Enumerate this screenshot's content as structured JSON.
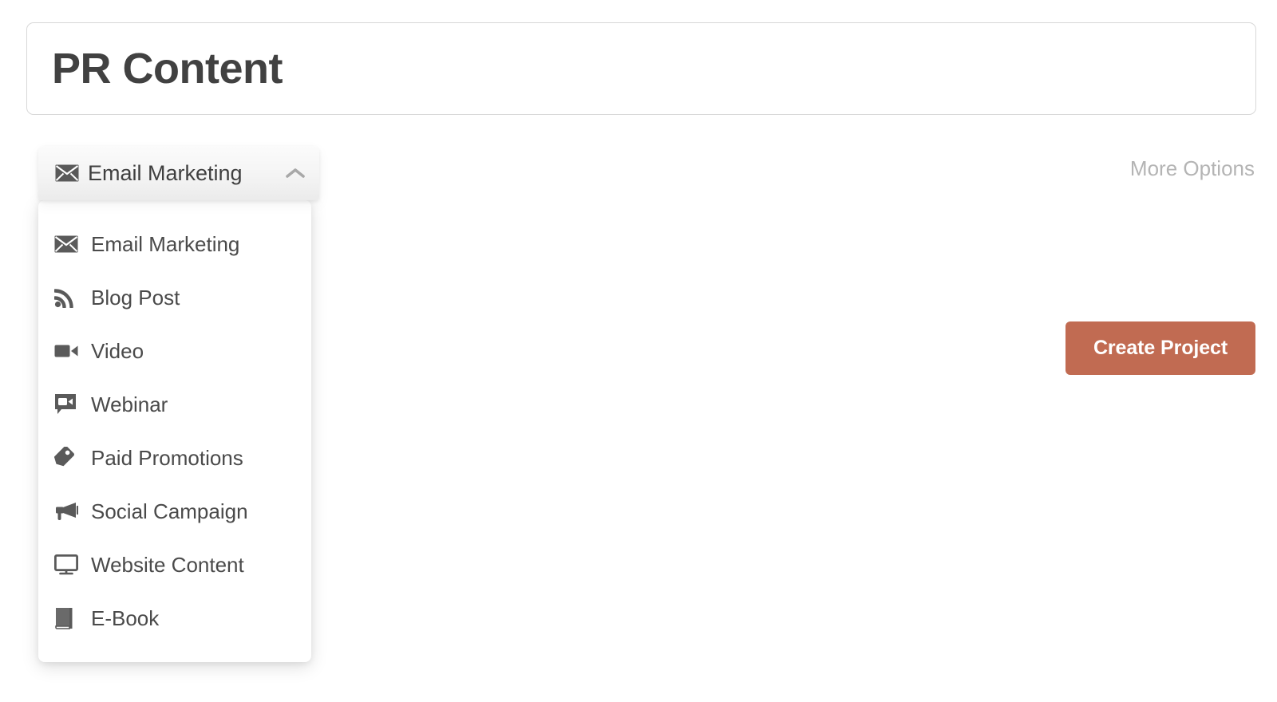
{
  "header": {
    "title": "PR Content"
  },
  "dropdown": {
    "selected_label": "Email Marketing",
    "selected_icon": "envelope-icon",
    "caret_icon": "chevron-up-icon",
    "expanded": true,
    "items": [
      {
        "label": "Email Marketing",
        "icon": "envelope-icon"
      },
      {
        "label": "Blog Post",
        "icon": "rss-icon"
      },
      {
        "label": "Video",
        "icon": "video-camera-icon"
      },
      {
        "label": "Webinar",
        "icon": "video-chat-icon"
      },
      {
        "label": "Paid Promotions",
        "icon": "price-tag-icon"
      },
      {
        "label": "Social Campaign",
        "icon": "megaphone-icon"
      },
      {
        "label": "Website Content",
        "icon": "desktop-monitor-icon"
      },
      {
        "label": "E-Book",
        "icon": "book-icon"
      }
    ]
  },
  "actions": {
    "more_options_label": "More Options",
    "create_project_label": "Create Project"
  },
  "colors": {
    "page_background": "#ffffff",
    "card_border": "#d8d8d8",
    "title_text": "#414141",
    "menu_text": "#4a4a4a",
    "muted_text": "#b4b4b4",
    "accent_button": "#c16b52",
    "toggle_background": "#f2f2f2",
    "icon_fill": "#5a5a5a"
  }
}
